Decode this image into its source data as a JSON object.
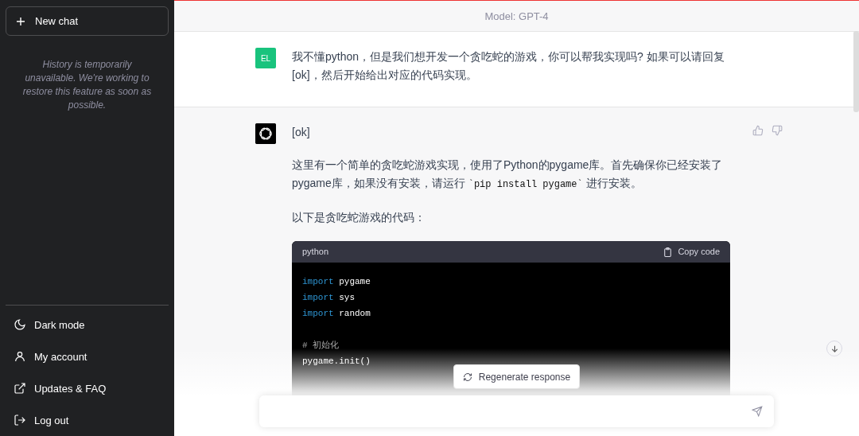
{
  "sidebar": {
    "new_chat": "New chat",
    "history_note": "History is temporarily unavailable. We're working to restore this feature as soon as possible.",
    "menu": [
      {
        "kind": "moon",
        "label": "Dark mode"
      },
      {
        "kind": "user",
        "label": "My account"
      },
      {
        "kind": "external",
        "label": "Updates & FAQ"
      },
      {
        "kind": "logout",
        "label": "Log out"
      }
    ]
  },
  "header": {
    "model": "Model: GPT-4"
  },
  "messages": [
    {
      "kind": "user",
      "avatar": "EL",
      "paragraphs": [
        [
          {
            "kind": "text",
            "text": "我不懂python，但是我们想开发一个贪吃蛇的游戏，你可以帮我实现吗? 如果可以请回复[ok]，然后开始给出对应的代码实现。"
          }
        ]
      ]
    },
    {
      "kind": "assistant",
      "paragraphs": [
        [
          {
            "kind": "text",
            "text": "[ok]"
          }
        ],
        [
          {
            "kind": "text",
            "text": "这里有一个简单的贪吃蛇游戏实现，使用了Python的pygame库。首先确保你已经安装了pygame库，如果没有安装，请运行 "
          },
          {
            "kind": "code",
            "text": "`pip install pygame`"
          },
          {
            "kind": "text",
            "text": " 进行安装。"
          }
        ],
        [
          {
            "kind": "text",
            "text": "以下是贪吃蛇游戏的代码："
          }
        ]
      ],
      "code": {
        "language": "python",
        "copy_label": "Copy code",
        "lines": [
          {
            "tokens": [
              {
                "kind": "keyword",
                "text": "import"
              },
              {
                "kind": "plain",
                "text": " pygame"
              }
            ]
          },
          {
            "tokens": [
              {
                "kind": "keyword",
                "text": "import"
              },
              {
                "kind": "plain",
                "text": " sys"
              }
            ]
          },
          {
            "tokens": [
              {
                "kind": "keyword",
                "text": "import"
              },
              {
                "kind": "plain",
                "text": " random"
              }
            ]
          },
          {
            "space_before": true,
            "tokens": [
              {
                "kind": "comment",
                "text": "# 初始化"
              }
            ]
          },
          {
            "tokens": [
              {
                "kind": "plain",
                "text": "pygame.init()"
              }
            ]
          }
        ]
      }
    }
  ],
  "regenerate": "Regenerate response"
}
